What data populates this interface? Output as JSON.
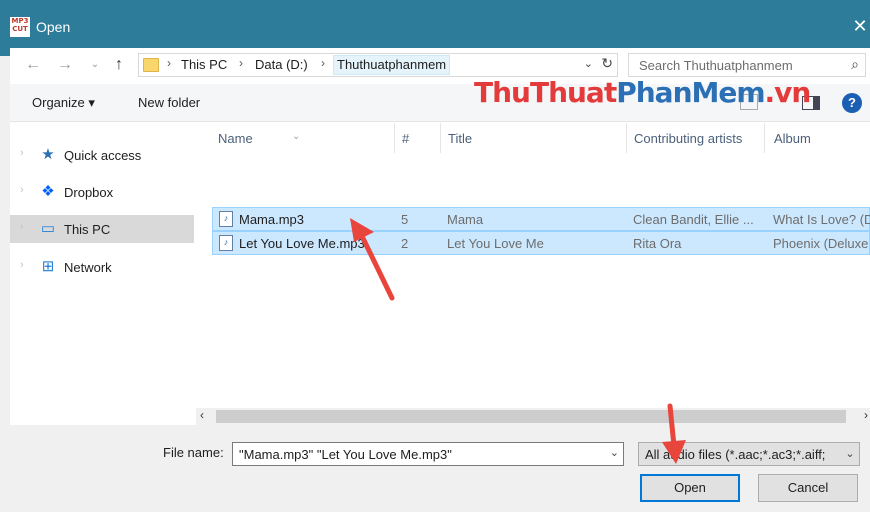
{
  "window": {
    "app_icon_text": "MP3 CUT",
    "title": "Open",
    "close_glyph": "✕"
  },
  "address": {
    "crumbs": [
      "This PC",
      "Data (D:)",
      "Thuthuatphanmem"
    ],
    "search_placeholder": "Search Thuthuatphanmem"
  },
  "toolbar": {
    "organize_label": "Organize ▾",
    "new_folder_label": "New folder",
    "help_glyph": "?"
  },
  "watermark": {
    "part1": "ThuThuat",
    "part2": "PhanMem",
    "part3": ".vn"
  },
  "nav": {
    "items": [
      {
        "label": "Quick access",
        "icon": "star-icon",
        "selected": false
      },
      {
        "label": "Dropbox",
        "icon": "dropbox-icon",
        "selected": false
      },
      {
        "label": "This PC",
        "icon": "computer-icon",
        "selected": true
      },
      {
        "label": "Network",
        "icon": "network-icon",
        "selected": false
      }
    ]
  },
  "files": {
    "columns": [
      "Name",
      "#",
      "Title",
      "Contributing artists",
      "Album"
    ],
    "rows": [
      {
        "name": "Mama.mp3",
        "num": "5",
        "title": "Mama",
        "artists": "Clean Bandit, Ellie ...",
        "album": "What Is Love? (De"
      },
      {
        "name": "Let You Love Me.mp3",
        "num": "2",
        "title": "Let You Love Me",
        "artists": "Rita Ora",
        "album": "Phoenix (Deluxe E"
      }
    ]
  },
  "bottom": {
    "file_name_label": "File name:",
    "file_name_value": "\"Mama.mp3\" \"Let You Love Me.mp3\"",
    "filter_value": "All audio files (*.aac;*.ac3;*.aiff;",
    "open_label": "Open",
    "cancel_label": "Cancel"
  },
  "colors": {
    "titlebar": "#2d7d9a",
    "selection": "#cce8ff",
    "annotation_arrow": "#e8453c"
  }
}
